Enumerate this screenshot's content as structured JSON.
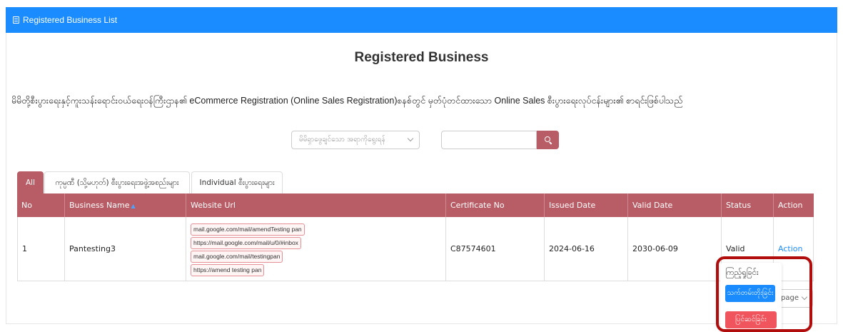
{
  "header": {
    "title": "Registered Business List",
    "icon": "list-icon"
  },
  "page": {
    "title": "Registered Business",
    "description": "မိမိတို့စီးပွားရေးနှင့်ကူးသန်းရောင်းဝယ်ရေးဝန်ကြီးဌာန၏ eCommerce Registration (Online Sales Registration)စနစ်တွင် မှတ်ပုံတင်ထားသော Online Sales စီးပွားရေးလုပ်ငန်းများ၏ စာရင်းဖြစ်ပါသည်"
  },
  "filters": {
    "select_placeholder": "မိမိရှာဖွေချင်သော အရာကိုရွေးရန်",
    "search_value": "",
    "search_icon": "search-icon"
  },
  "tabs": [
    {
      "label": "All",
      "active": true
    },
    {
      "label": "ကုမ္ပဏီ (သို့မဟုတ်) စီးပွားရေးအဖွဲ့အစည်းများ",
      "active": false
    },
    {
      "label": "Individual စီးပွားရေးများ",
      "active": false
    }
  ],
  "table": {
    "columns": [
      "No",
      "Business Name",
      "Website Url",
      "Certificate No",
      "Issued Date",
      "Valid Date",
      "Status",
      "Action"
    ],
    "sort_indicator": "▲",
    "rows": [
      {
        "no": "1",
        "business_name": "Pantesting3",
        "urls": [
          "mail.google.com/mail/amendTesting pan",
          "https://mail.google.com/mail/u/0/#inbox",
          "mail.google.com/mail/testingpan",
          "https://amend testing pan"
        ],
        "certificate_no": "C87574601",
        "issued_date": "2024-06-16",
        "valid_date": "2030-06-09",
        "status": "Valid",
        "action": "Action"
      }
    ]
  },
  "action_menu": {
    "view": "ကြည့်ရှုခြင်း",
    "edit": "သက်တမ်းတိုးခြင်း",
    "delete": "ပြင်ဆင်ခြင်း"
  },
  "pagination": {
    "per_page_label": "page"
  },
  "colors": {
    "header_blue": "#1a8cff",
    "table_header": "#b85c65",
    "edit_button": "#1a8cff",
    "delete_button": "#f0545c",
    "highlight": "#b10d0d"
  }
}
